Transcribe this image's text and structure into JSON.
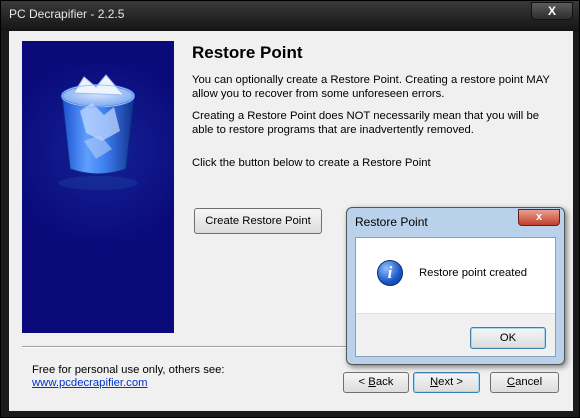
{
  "window": {
    "title": "PC Decrapifier - 2.2.5",
    "close_glyph": "X"
  },
  "side_panel": {
    "icon": "recycle-bin-icon"
  },
  "page": {
    "heading": "Restore Point",
    "paragraph1": "You can optionally create a Restore Point.  Creating a restore point MAY allow you to recover from some unforeseen errors.",
    "paragraph2": "Creating a Restore Point does NOT necessarily mean that you will be able to restore programs that are inadvertently removed.",
    "paragraph3": "Click the button below to create a Restore Point",
    "create_button": "Create Restore Point"
  },
  "footer": {
    "note": "Free for personal use only, others see:",
    "link": "www.pcdecrapifier.com",
    "back_label_accel": "B",
    "back_label_rest": "ack",
    "back_prefix": "< ",
    "next_label_accel": "N",
    "next_label_rest": "ext >",
    "cancel_label_accel": "C",
    "cancel_label_rest": "ancel"
  },
  "dialog": {
    "title": "Restore Point",
    "close_glyph": "x",
    "message": "Restore point created",
    "icon": "info-icon",
    "icon_glyph": "i",
    "ok_label": "OK"
  },
  "colors": {
    "side_panel_bg": "#0a0a7a",
    "link": "#0033cc"
  }
}
